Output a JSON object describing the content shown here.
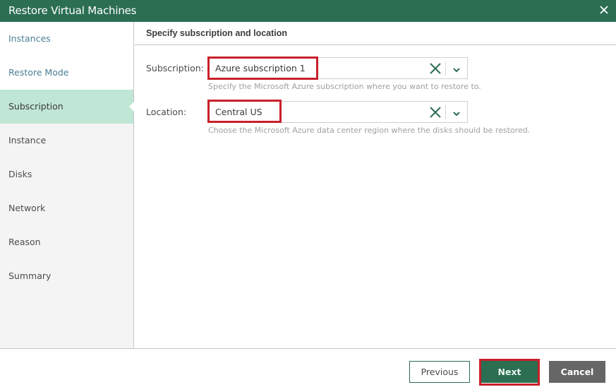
{
  "window": {
    "title": "Restore Virtual Machines",
    "close_icon": "close-icon"
  },
  "sidebar": {
    "items": [
      {
        "label": "Instances",
        "state": "done"
      },
      {
        "label": "Restore Mode",
        "state": "done"
      },
      {
        "label": "Subscription",
        "state": "active"
      },
      {
        "label": "Instance",
        "state": "pending"
      },
      {
        "label": "Disks",
        "state": "pending"
      },
      {
        "label": "Network",
        "state": "pending"
      },
      {
        "label": "Reason",
        "state": "pending"
      },
      {
        "label": "Summary",
        "state": "pending"
      }
    ]
  },
  "main": {
    "section_title": "Specify subscription and location",
    "subscription": {
      "label": "Subscription:",
      "value": "Azure subscription 1",
      "hint": "Specify the Microsoft Azure subscription where you want to restore to."
    },
    "location": {
      "label": "Location:",
      "value": "Central US",
      "hint": "Choose the Microsoft Azure data center region where the disks should be restored."
    }
  },
  "footer": {
    "previous_label": "Previous",
    "next_label": "Next",
    "cancel_label": "Cancel"
  },
  "colors": {
    "brand": "#2b6e52",
    "active_step": "#c0e6d5",
    "annotation_highlight": "#c8202a",
    "cancel": "#666666"
  }
}
